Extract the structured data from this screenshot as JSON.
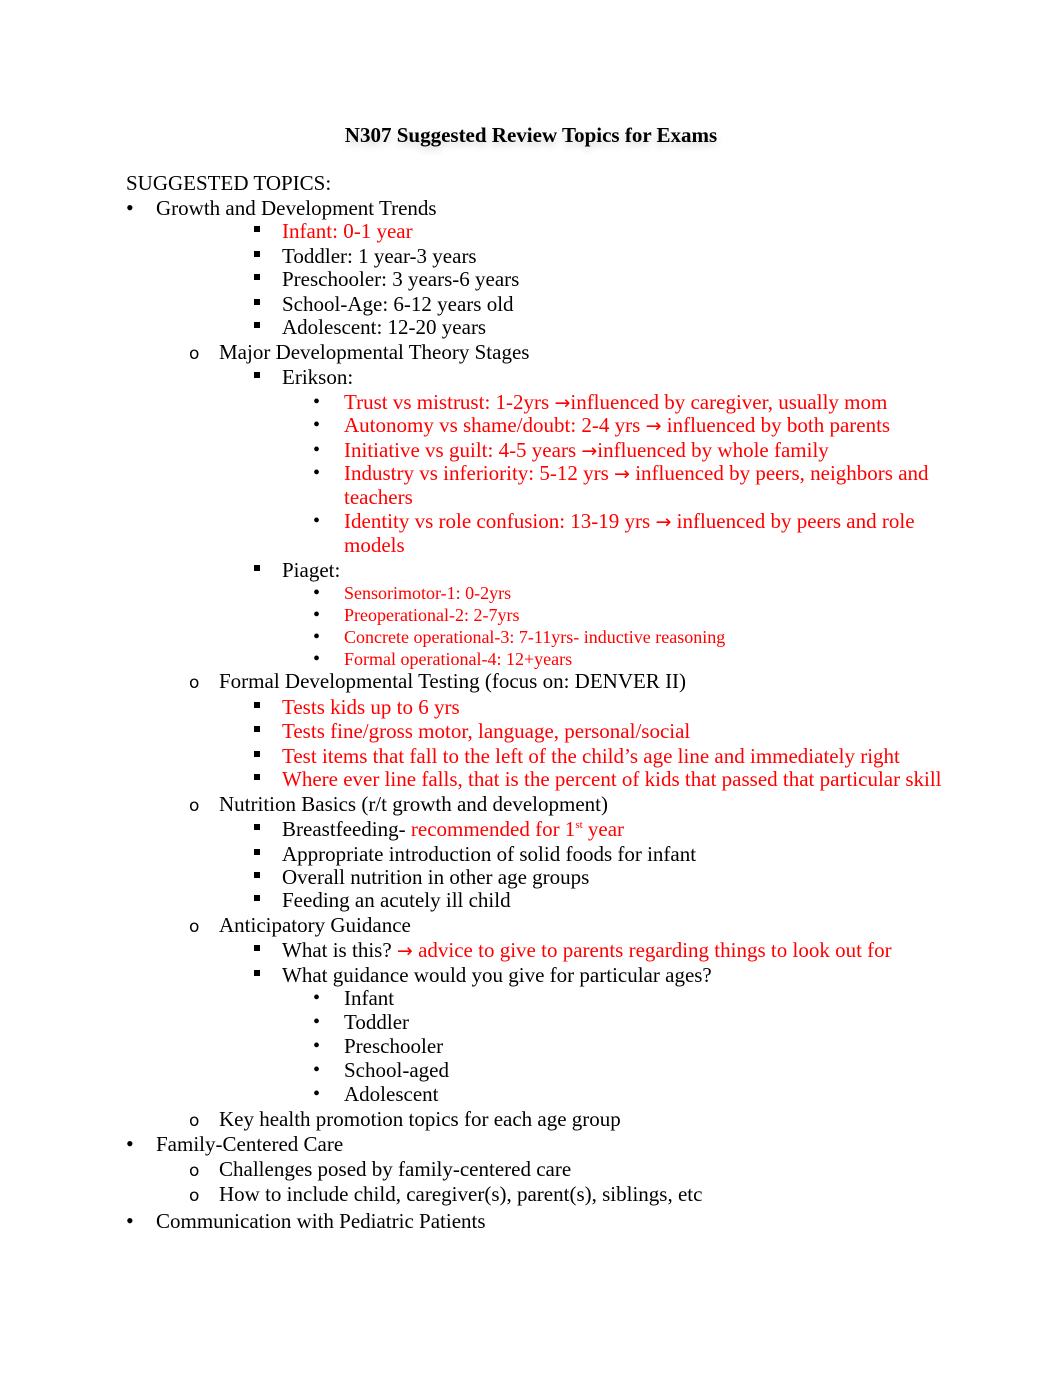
{
  "document": {
    "title": "N307 Suggested Review Topics for Exams",
    "heading": "SUGGESTED TOPICS:",
    "colors": {
      "text": "#000000",
      "highlight": "#ff0000"
    },
    "arrow_icon": "→",
    "lines": [
      {
        "level": 1,
        "text": "Growth and Development Trends"
      },
      {
        "level": 3,
        "text": "Infant: 0-1 year",
        "red": true
      },
      {
        "level": 3,
        "text": "Toddler: 1 year-3 years"
      },
      {
        "level": 3,
        "text": "Preschooler: 3 years-6 years"
      },
      {
        "level": 3,
        "text": "School-Age: 6-12 years old"
      },
      {
        "level": 3,
        "text": "Adolescent: 12-20 years"
      },
      {
        "level": 2,
        "text": "Major Developmental Theory Stages"
      },
      {
        "level": 3,
        "text": "Erikson:"
      },
      {
        "level": 4,
        "text": "Trust vs mistrust: 1-2yrs ",
        "after": "influenced by caregiver, usually mom",
        "red": true
      },
      {
        "level": 4,
        "text": "Autonomy vs shame/doubt: 2-4 yrs ",
        "after": " influenced by both parents",
        "red": true
      },
      {
        "level": 4,
        "text": "Initiative vs guilt: 4-5 years ",
        "after": "influenced by whole family",
        "red": true
      },
      {
        "level": 4,
        "text": "Industry vs inferiority: 5-12 yrs ",
        "after": " influenced by peers, neighbors and",
        "red": true
      },
      {
        "level": 4,
        "text": "teachers",
        "red": true,
        "continuation": true
      },
      {
        "level": 4,
        "text": "Identity vs role confusion: 13-19 yrs ",
        "after": " influenced by peers and role",
        "red": true
      },
      {
        "level": 4,
        "text": "models",
        "red": true,
        "continuation": true
      },
      {
        "level": 3,
        "text": "Piaget:"
      },
      {
        "level": 4,
        "text": "Sensorimotor-1: 0-2yrs",
        "red": true,
        "small": true
      },
      {
        "level": 4,
        "text": "Preoperational-2: 2-7yrs",
        "red": true,
        "small": true
      },
      {
        "level": 4,
        "text": "Concrete operational-3: 7-11yrs- inductive reasoning",
        "red": true,
        "small": true
      },
      {
        "level": 4,
        "text": "Formal operational-4: 12+years",
        "red": true,
        "small": true
      },
      {
        "level": 2,
        "text": "Formal Developmental Testing (focus on: DENVER II)"
      },
      {
        "level": 3,
        "text": "Tests kids up to 6 yrs",
        "red": true
      },
      {
        "level": 3,
        "text": "Tests fine/gross motor, language, personal/social",
        "red": true
      },
      {
        "level": 3,
        "text": "Test items that fall to the left of the child’s age line and immediately right",
        "red": true
      },
      {
        "level": 3,
        "text": "Where ever line falls, that is the percent of kids that passed that particular skill",
        "red": true
      },
      {
        "level": 2,
        "text": "Nutrition Basics (r/t growth and development)"
      },
      {
        "level": 3,
        "text": "Breastfeeding- ",
        "red_part": "recommended for 1",
        "sup": "st",
        "red_tail": " year"
      },
      {
        "level": 3,
        "text": "Appropriate introduction of solid foods for infant"
      },
      {
        "level": 3,
        "text": "Overall nutrition in other age groups"
      },
      {
        "level": 3,
        "text": "Feeding an acutely ill child"
      },
      {
        "level": 2,
        "text": "Anticipatory Guidance"
      },
      {
        "level": 3,
        "text": "What is this? ",
        "arrow_black": true,
        "after": " advice to give to parents regarding things to look out for"
      },
      {
        "level": 3,
        "text": "What guidance would you give for particular ages?"
      },
      {
        "level": 4,
        "text": "Infant"
      },
      {
        "level": 4,
        "text": "Toddler"
      },
      {
        "level": 4,
        "text": "Preschooler"
      },
      {
        "level": 4,
        "text": "School-aged"
      },
      {
        "level": 4,
        "text": "Adolescent"
      },
      {
        "level": 2,
        "text": "Key health promotion topics for each age group"
      },
      {
        "level": 1,
        "text": "Family-Centered Care"
      },
      {
        "level": 2,
        "text": "Challenges posed by family-centered care"
      },
      {
        "level": 2,
        "text": "How to include child, caregiver(s), parent(s), siblings, etc"
      },
      {
        "level": 1,
        "text": "Communication with Pediatric Patients"
      }
    ]
  }
}
